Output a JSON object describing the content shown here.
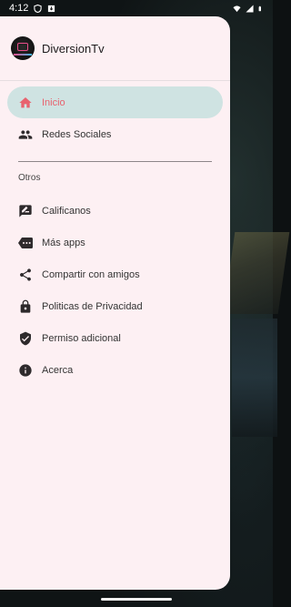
{
  "status_bar": {
    "time": "4:12",
    "icons": [
      "vpn-shield-icon",
      "download-icon",
      "wifi-icon",
      "signal-icon",
      "battery-icon"
    ]
  },
  "drawer": {
    "app_name": "DiversionTv",
    "logo": "diversiontv-logo",
    "primary_items": [
      {
        "label": "Inicio",
        "icon": "home-icon",
        "active": true
      },
      {
        "label": "Redes Sociales",
        "icon": "people-icon",
        "active": false
      }
    ],
    "section_title": "Otros",
    "secondary_items": [
      {
        "label": "Calificanos",
        "icon": "rate-review-icon"
      },
      {
        "label": "Más apps",
        "icon": "more-apps-icon"
      },
      {
        "label": "Compartir con amigos",
        "icon": "share-icon"
      },
      {
        "label": "Politicas de Privacidad",
        "icon": "lock-icon"
      },
      {
        "label": "Permiso adicional",
        "icon": "verified-shield-icon"
      },
      {
        "label": "Acerca",
        "icon": "info-icon"
      }
    ]
  },
  "colors": {
    "drawer_bg": "#fdf0f3",
    "active_bg": "#cfe3e2",
    "accent": "#e8626e"
  }
}
